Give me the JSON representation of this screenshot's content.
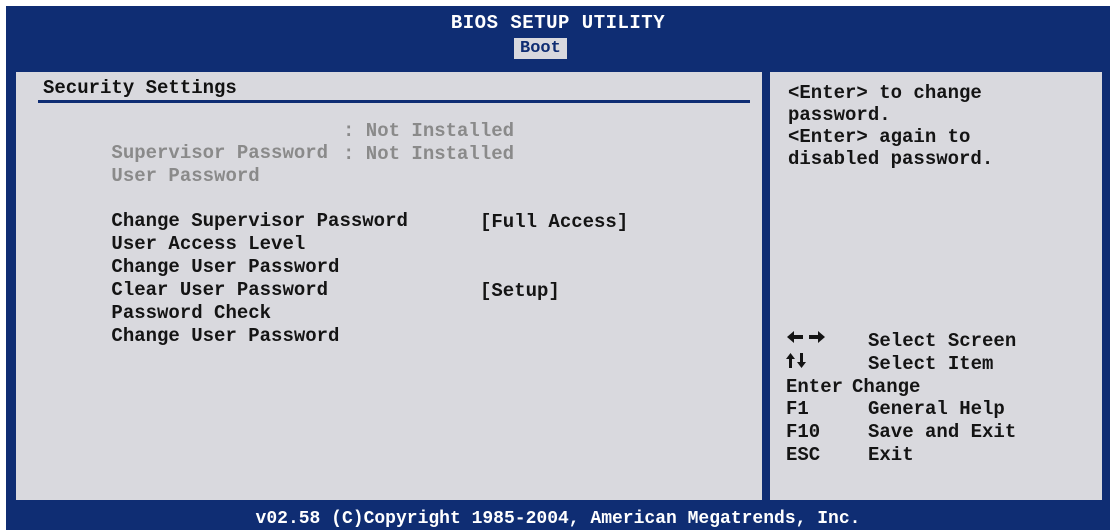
{
  "header": {
    "title": "BIOS SETUP UTILITY",
    "active_tab": "Boot"
  },
  "main": {
    "section_title": "Security Settings",
    "status": [
      {
        "label": "Supervisor Password",
        "value": ": Not Installed"
      },
      {
        "label": "User Password",
        "value": ": Not Installed"
      }
    ],
    "items": [
      {
        "label": "Change Supervisor Password",
        "value": ""
      },
      {
        "label": "User Access Level",
        "value": "[Full Access]"
      },
      {
        "label": "Change User Password",
        "value": ""
      },
      {
        "label": "Clear User Password",
        "value": ""
      },
      {
        "label": "Password Check",
        "value": "[Setup]"
      },
      {
        "label": "Change User Password",
        "value": ""
      }
    ]
  },
  "help": {
    "text": "<Enter> to change\npassword.\n<Enter> again to\ndisabled password.",
    "keys": [
      {
        "key": "",
        "icon": "left-right-arrows-icon",
        "desc": "Select Screen"
      },
      {
        "key": "",
        "icon": "up-down-arrows-icon",
        "desc": "Select Item"
      },
      {
        "key": "Enter",
        "desc": "Change"
      },
      {
        "key": "F1",
        "desc": "General Help"
      },
      {
        "key": "F10",
        "desc": "Save and Exit"
      },
      {
        "key": "ESC",
        "desc": "Exit"
      }
    ]
  },
  "footer": {
    "text": "v02.58 (C)Copyright 1985-2004, American Megatrends, Inc."
  },
  "colors": {
    "frame_blue": "#0f2d73",
    "panel_gray": "#d9d9de",
    "dim_text": "#8a8a8a",
    "text": "#141414"
  }
}
